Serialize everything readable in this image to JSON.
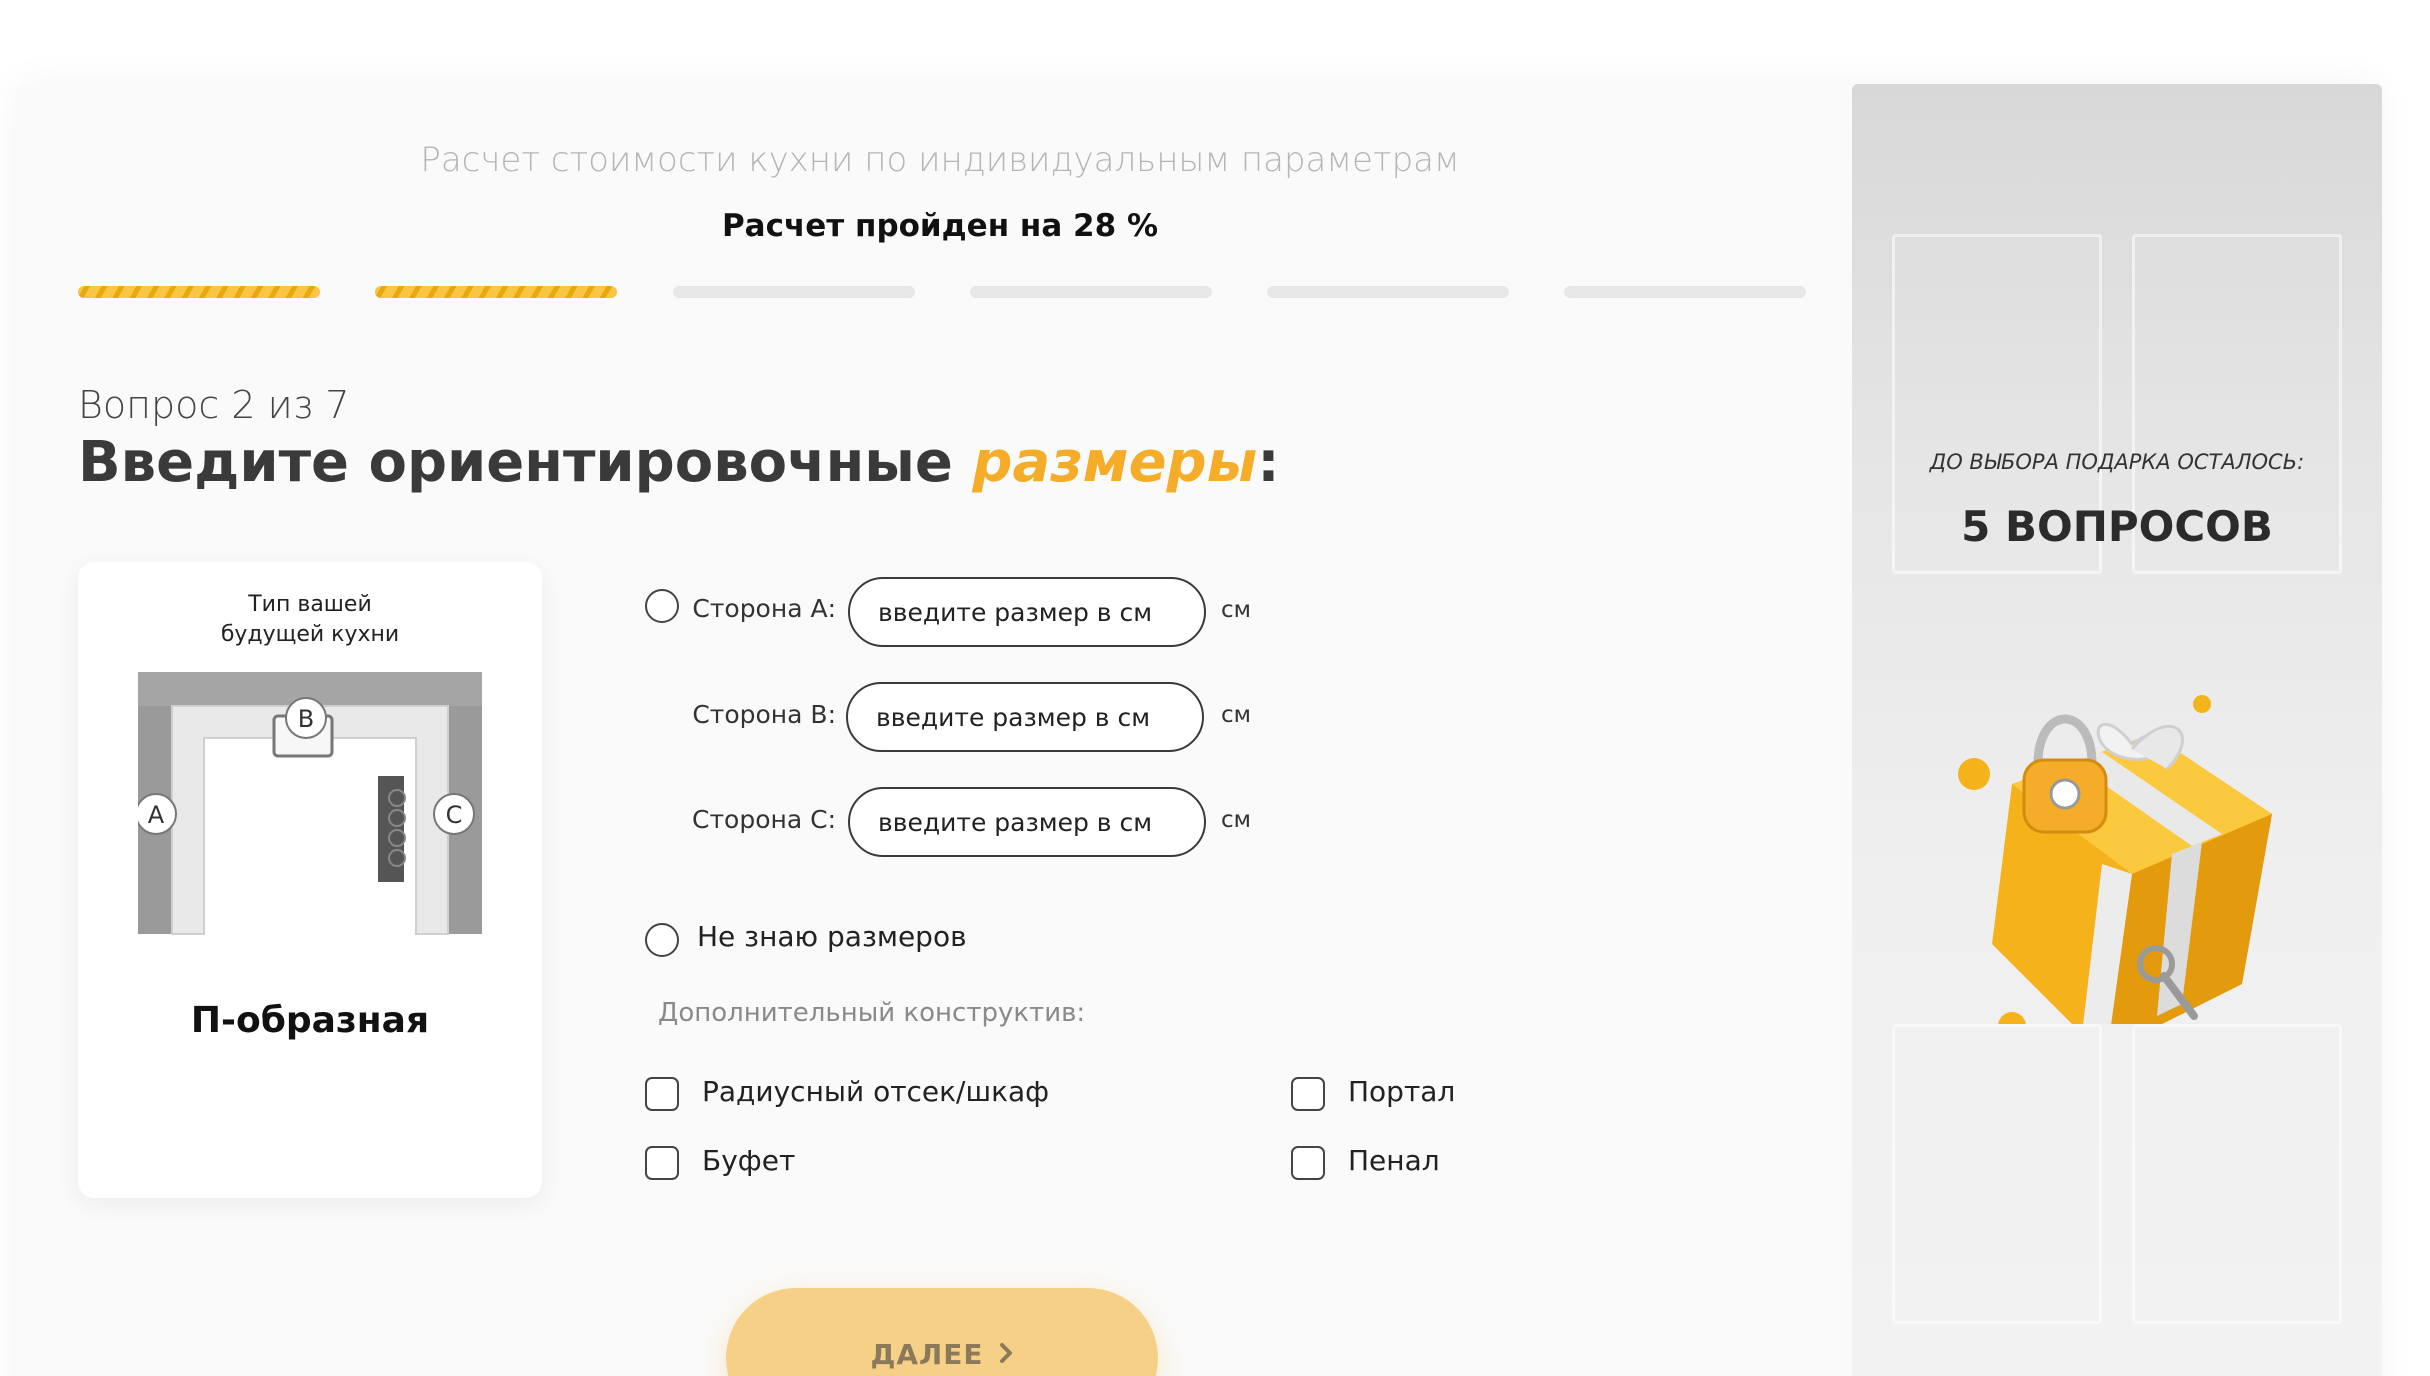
{
  "quiz": {
    "title": "Расчет стоимости кухни по индивидуальным параметрам",
    "progress_text": "Расчет пройден на 28 %",
    "progress_steps_done": 2,
    "progress_steps_total": 6
  },
  "question": {
    "counter": "Вопрос 2 из 7",
    "title_main": "Введите ориентировочные ",
    "title_accent": "размеры",
    "title_end": ":"
  },
  "kitchen": {
    "type_label_line1": "Тип вашей",
    "type_label_line2": "будущей кухни",
    "name": "П-образная",
    "markers": {
      "a": "A",
      "b": "B",
      "c": "C"
    }
  },
  "sizes": {
    "side_a_label": "Сторона А:",
    "side_b_label": "Сторона В:",
    "side_c_label": "Сторона С:",
    "placeholder": "введите размер в см",
    "unit": "см",
    "unknown_label": "Не знаю размеров"
  },
  "extras": {
    "title": "Дополнительный конструктив:",
    "options": [
      "Радиусный отсек/шкаф",
      "Портал",
      "Буфет",
      "Пенал"
    ]
  },
  "next_button": {
    "label": "ДАЛЕЕ",
    "icon": "chevron-right-icon"
  },
  "gift": {
    "caption": "ДО ВЫБОРА ПОДАРКА ОСТАЛОСЬ:",
    "count": "5 ВОПРОСОВ"
  },
  "colors": {
    "accent": "#f5ac29",
    "progress_done": "#f8c545",
    "button": "#f7d088"
  }
}
